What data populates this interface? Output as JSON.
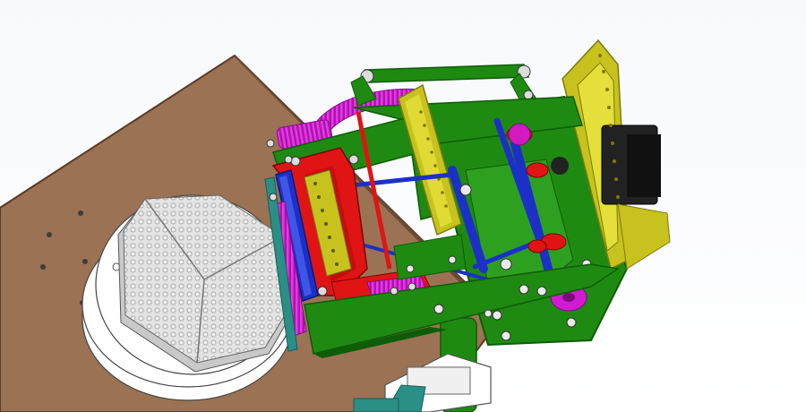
{
  "scene": {
    "kind": "cad-assembly-render",
    "colors": {
      "background_top": "#f7f9fc",
      "background_bottom": "#ffffff",
      "table_wood": "#9b7254",
      "table_edge": "#5a3a26",
      "white_parts": "#ffffff",
      "honeycomb": "#d9d9d9",
      "frame_green": "#1f8a12",
      "frame_green_dark": "#0f5c08",
      "rail_olive": "#c7c21e",
      "rail_olive_dark": "#7d7a0e",
      "bracket_red": "#e01414",
      "roller_blue": "#1c30c8",
      "gear_magenta": "#d21ad2",
      "motor_black": "#222222",
      "teal_part": "#2a8f86"
    }
  }
}
